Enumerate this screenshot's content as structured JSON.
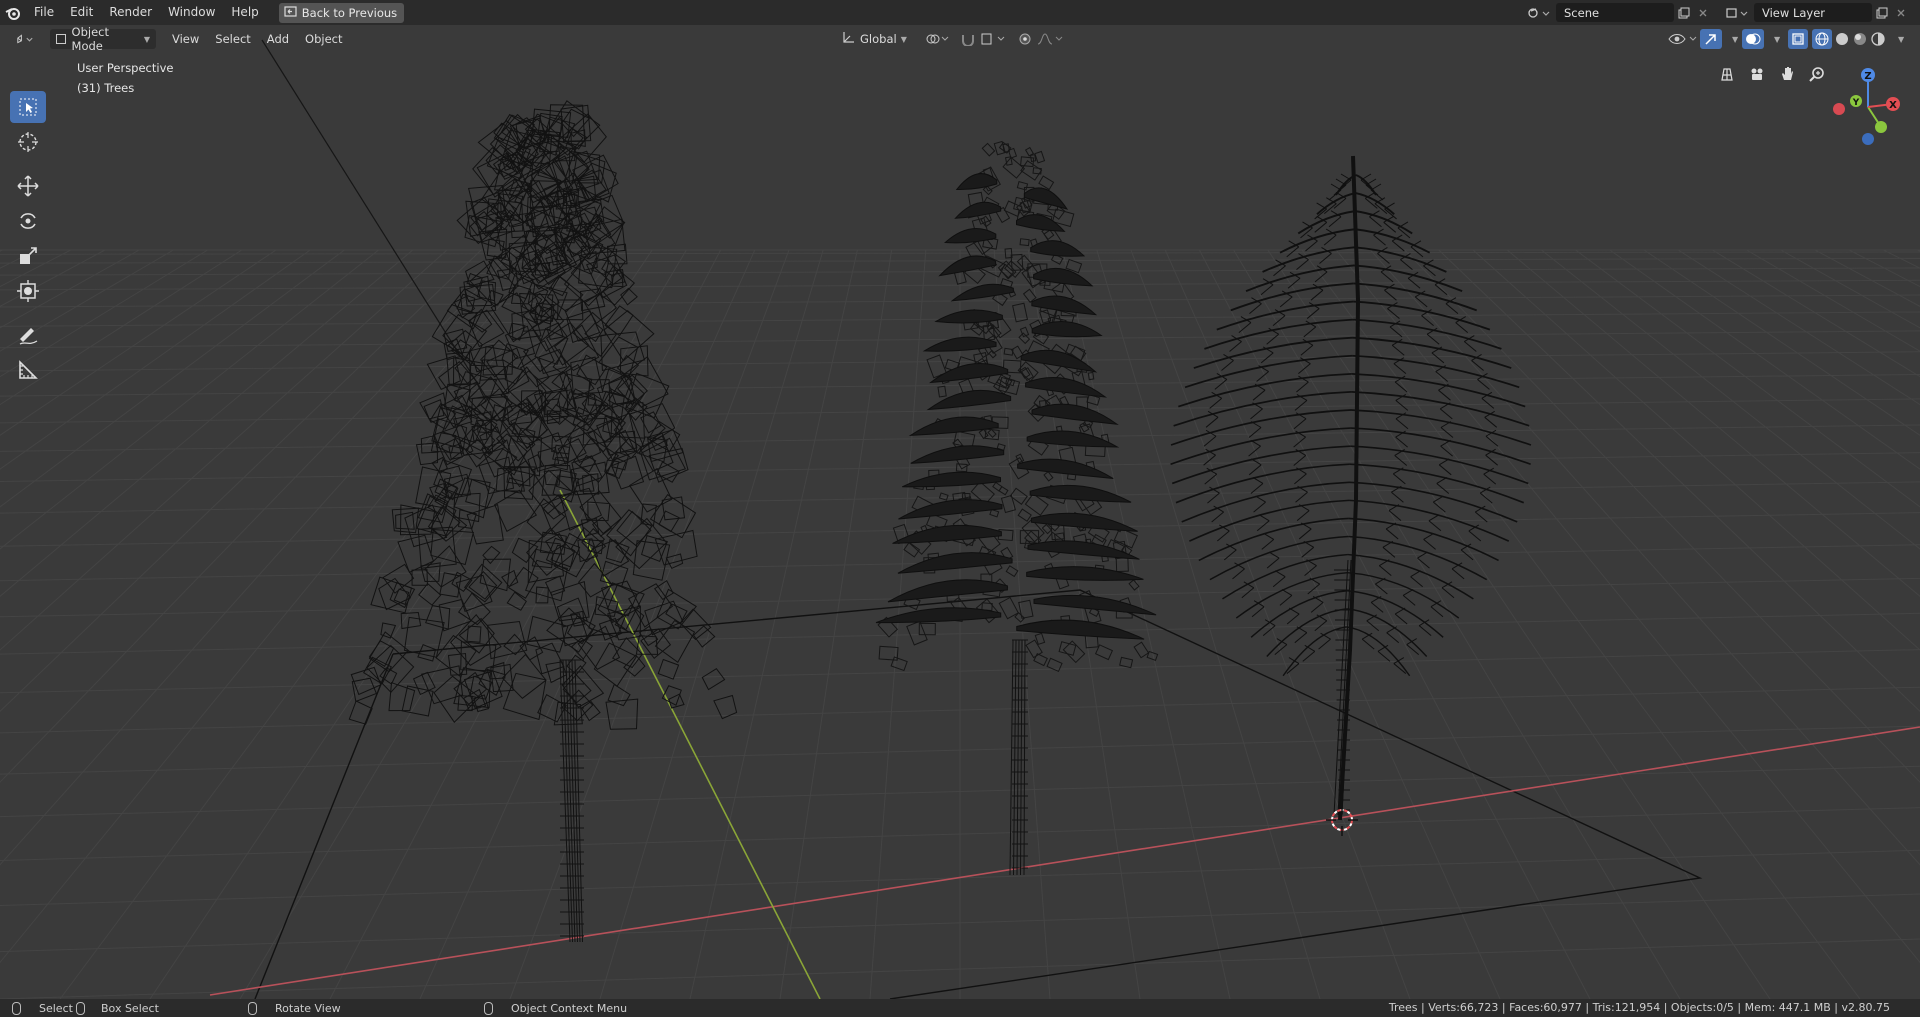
{
  "menu": {
    "items": [
      "File",
      "Edit",
      "Render",
      "Window",
      "Help"
    ],
    "back_button": "Back to Previous"
  },
  "scene": {
    "name": "Scene"
  },
  "view_layer": {
    "name": "View Layer"
  },
  "header": {
    "mode": "Object Mode",
    "menus": [
      "View",
      "Select",
      "Add",
      "Object"
    ],
    "orientation": "Global"
  },
  "viewport": {
    "perspective": "User Perspective",
    "collection": "(31) Trees"
  },
  "gizmo": {
    "z": "Z",
    "y": "Y",
    "x": "X"
  },
  "statusbar": {
    "select": "Select",
    "box_select": "Box Select",
    "rotate_view": "Rotate View",
    "context_menu": "Object Context Menu",
    "stats": "Trees | Verts:66,723 | Faces:60,977 | Tris:121,954 | Objects:0/5 | Mem: 447.1 MB | v2.80.75"
  },
  "colors": {
    "accent": "#4772b3",
    "x_axis": "#e24e53",
    "y_axis": "#8bc73e",
    "z_axis": "#4f8ae6"
  },
  "icons": [
    "blender-logo-icon",
    "select-box-icon",
    "cursor-icon",
    "move-icon",
    "rotate-icon",
    "scale-icon",
    "transform-icon",
    "annotate-icon",
    "measure-icon"
  ]
}
